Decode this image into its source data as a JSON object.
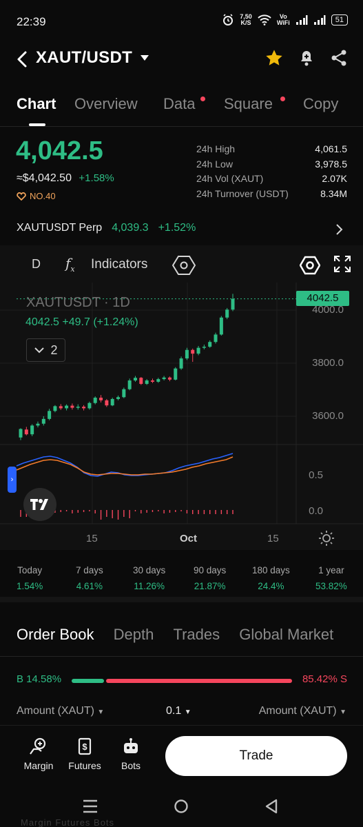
{
  "status": {
    "time": "22:39",
    "speed_value": "7,50",
    "speed_unit": "K/S",
    "vowifi_top": "Vo",
    "vowifi_bottom": "WiFi",
    "battery": "51"
  },
  "header": {
    "title": "XAUT/USDT"
  },
  "tabs": [
    {
      "label": "Chart",
      "active": true
    },
    {
      "label": "Overview"
    },
    {
      "label": "Data",
      "dot": true
    },
    {
      "label": "Square",
      "dot": true
    },
    {
      "label": "Copy"
    }
  ],
  "price": {
    "last": "4,042.5",
    "fiat": "≈$4,042.50",
    "change_pct": "+1.58%",
    "rank": "NO.40"
  },
  "stats": {
    "labels": [
      "24h High",
      "24h Low",
      "24h Vol (XAUT)",
      "24h Turnover (USDT)"
    ],
    "values": [
      "4,061.5",
      "3,978.5",
      "2.07K",
      "8.34M"
    ]
  },
  "perp": {
    "name": "XAUTUSDT Perp",
    "price": "4,039.3",
    "change": "+1.52%"
  },
  "chart_toolbar": {
    "interval": "D",
    "fx": "f",
    "fx_sub": "x",
    "indicators": "Indicators"
  },
  "chart_data": {
    "type": "candlestick",
    "symbol": "XAUTUSDT · 1D",
    "ohlc_summary": "4042.5 +49.7 (+1.24%)",
    "indicator_count": "2",
    "last_price_tag": "4042.5",
    "y_ticks": [
      "4000.0",
      "3800.0",
      "3600.0"
    ],
    "indicator_ticks": [
      "0.5",
      "0.0"
    ],
    "x_ticks": [
      "15",
      "Oct",
      "15"
    ],
    "ylim": [
      3540,
      4085
    ],
    "candles": [
      [
        3520,
        3552,
        3510,
        3555
      ],
      [
        3550,
        3532,
        3528,
        3560
      ],
      [
        3532,
        3565,
        3525,
        3570
      ],
      [
        3565,
        3572,
        3558,
        3580
      ],
      [
        3572,
        3590,
        3565,
        3600
      ],
      [
        3590,
        3620,
        3585,
        3628
      ],
      [
        3620,
        3638,
        3615,
        3642
      ],
      [
        3638,
        3630,
        3624,
        3646
      ],
      [
        3630,
        3640,
        3622,
        3645
      ],
      [
        3640,
        3632,
        3625,
        3648
      ],
      [
        3632,
        3636,
        3625,
        3645
      ],
      [
        3636,
        3630,
        3622,
        3642
      ],
      [
        3630,
        3650,
        3625,
        3655
      ],
      [
        3650,
        3670,
        3645,
        3675
      ],
      [
        3670,
        3660,
        3652,
        3680
      ],
      [
        3660,
        3641,
        3635,
        3665
      ],
      [
        3641,
        3665,
        3638,
        3670
      ],
      [
        3665,
        3672,
        3660,
        3678
      ],
      [
        3672,
        3702,
        3668,
        3708
      ],
      [
        3702,
        3735,
        3698,
        3742
      ],
      [
        3735,
        3745,
        3730,
        3752
      ],
      [
        3745,
        3722,
        3718,
        3748
      ],
      [
        3722,
        3735,
        3718,
        3740
      ],
      [
        3735,
        3730,
        3725,
        3742
      ],
      [
        3730,
        3740,
        3726,
        3745
      ],
      [
        3740,
        3746,
        3735,
        3752
      ],
      [
        3746,
        3738,
        3732,
        3750
      ],
      [
        3738,
        3780,
        3735,
        3785
      ],
      [
        3780,
        3818,
        3775,
        3825
      ],
      [
        3818,
        3850,
        3812,
        3858
      ],
      [
        3850,
        3836,
        3805,
        3855
      ],
      [
        3836,
        3858,
        3830,
        3865
      ],
      [
        3858,
        3862,
        3852,
        3870
      ],
      [
        3862,
        3880,
        3858,
        3886
      ],
      [
        3880,
        3908,
        3874,
        3915
      ],
      [
        3908,
        3972,
        3904,
        3978
      ],
      [
        3972,
        4002,
        3966,
        4008
      ],
      [
        4002,
        4042.5,
        3996,
        4061.5
      ]
    ]
  },
  "performance": [
    {
      "label": "Today",
      "value": "1.54%"
    },
    {
      "label": "7 days",
      "value": "4.61%"
    },
    {
      "label": "30 days",
      "value": "11.26%"
    },
    {
      "label": "90 days",
      "value": "21.87%"
    },
    {
      "label": "180 days",
      "value": "24.4%"
    },
    {
      "label": "1 year",
      "value": "53.82%"
    }
  ],
  "orderbook": {
    "tabs": [
      "Order Book",
      "Depth",
      "Trades",
      "Global Market"
    ],
    "buy_label": "B 14.58%",
    "sell_label": "85.42% S",
    "buy_ratio": 0.1458,
    "amount_left": "Amount (XAUT)",
    "precision": "0.1",
    "amount_right": "Amount (XAUT)"
  },
  "bottom_nav": {
    "margin": "Margin",
    "futures": "Futures",
    "bots": "Bots",
    "trade": "Trade"
  },
  "ghost_text": "Margin   Futures   Bots",
  "colors": {
    "up": "#2ebd85",
    "down": "#f6465d",
    "accent": "#2962ff",
    "star": "#f0b90b"
  }
}
